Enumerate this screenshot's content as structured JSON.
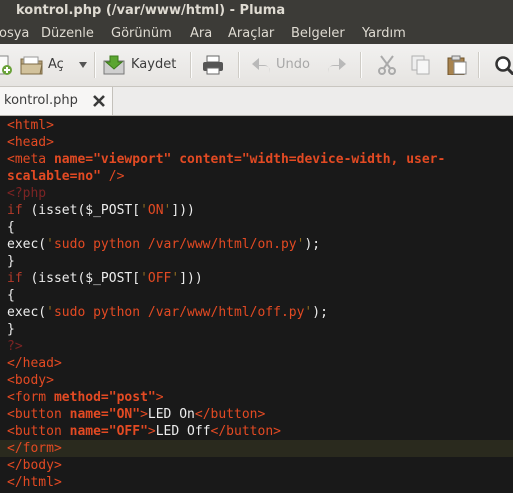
{
  "window": {
    "title": "kontrol.php (/var/www/html) - Pluma"
  },
  "menu": [
    "osya",
    "Düzenle",
    "Görünüm",
    "Ara",
    "Araçlar",
    "Belgeler",
    "Yardım"
  ],
  "toolbar": {
    "open_label": "Aç",
    "save_label": "Kaydet",
    "undo_label": "Undo",
    "icons": [
      "new-document-icon",
      "open-folder-icon",
      "dropdown-arrow-icon",
      "save-icon",
      "print-icon",
      "undo-icon",
      "redo-icon",
      "cut-icon",
      "copy-icon",
      "paste-icon",
      "search-icon"
    ]
  },
  "tab": {
    "label": "kontrol.php"
  },
  "code_lines": [
    "<html>",
    "<head>",
    "<meta name=\"viewport\" content=\"width=device-width, user-",
    "scalable=no\" />",
    "<?php",
    "if (isset($_POST['ON']))",
    "{",
    "exec('sudo python /var/www/html/on.py');",
    "}",
    "if (isset($_POST['OFF']))",
    "{",
    "exec('sudo python /var/www/html/off.py');",
    "}",
    "?>",
    "</head>",
    "<body>",
    "<form method=\"post\">",
    "<button name=\"ON\">LED On</button>",
    "<button name=\"OFF\">LED Off</button>",
    "</form>",
    "</body>",
    "</html>"
  ],
  "current_line": 20,
  "colors": {
    "tag": "#e34a23",
    "attribute": "#6d9c1f",
    "php_delimiter": "#7c2424",
    "background": "#191919",
    "plain": "#ededed"
  }
}
